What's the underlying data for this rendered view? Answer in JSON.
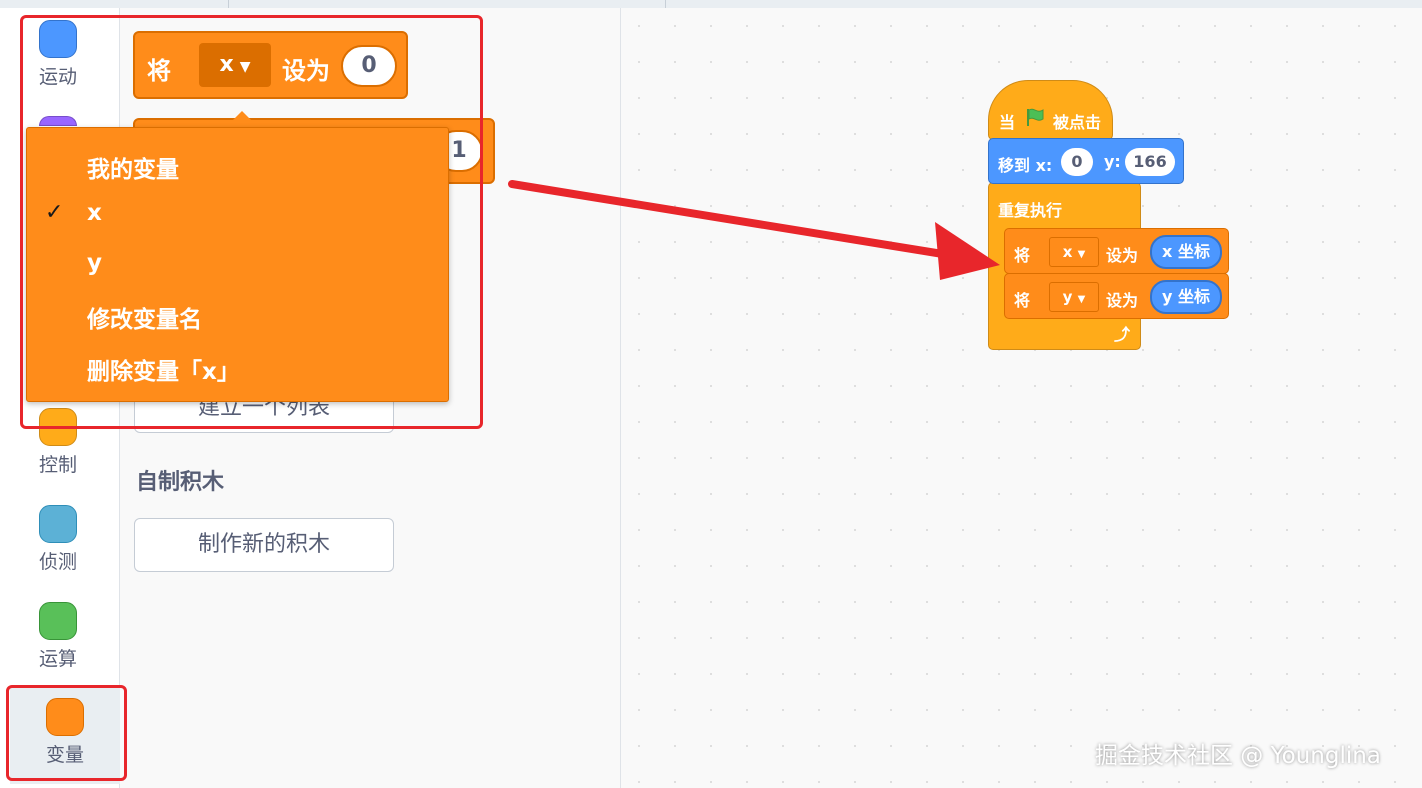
{
  "categories": [
    {
      "label": "运动",
      "color": "#4c97ff",
      "border": "#3373cc"
    },
    {
      "label": "控制",
      "color": "#ffab19",
      "border": "#cf8b17"
    },
    {
      "label": "侦测",
      "color": "#5cb1d6",
      "border": "#2e8eb8"
    },
    {
      "label": "运算",
      "color": "#59c059",
      "border": "#389438"
    },
    {
      "label": "变量",
      "color": "#ff8c1a",
      "border": "#db6e00"
    }
  ],
  "palette": {
    "set_block": {
      "prefix": "将",
      "variable": "x",
      "suffix": "设为",
      "value": "0"
    },
    "change_block": {
      "value": "1"
    },
    "make_list_button": "建立一个列表",
    "my_blocks_title": "自制积木",
    "make_block_button": "制作新的积木"
  },
  "dropdown_menu": {
    "items": [
      "我的变量",
      "x",
      "y",
      "修改变量名",
      "删除变量「x」"
    ],
    "checked": "x"
  },
  "script": {
    "hat": {
      "when": "当",
      "flag_icon": "green-flag-icon",
      "clicked": "被点击"
    },
    "goto": {
      "label": "移到 x:",
      "x": "0",
      "y_label": "y:",
      "y": "166"
    },
    "forever": {
      "label": "重复执行"
    },
    "inner": [
      {
        "prefix": "将",
        "variable": "x",
        "suffix": "设为",
        "reporter": "x 坐标"
      },
      {
        "prefix": "将",
        "variable": "y",
        "suffix": "设为",
        "reporter": "y 坐标"
      }
    ]
  },
  "watermark": "掘金技术社区 @ Younglina",
  "annotation_color": "#e8262b"
}
